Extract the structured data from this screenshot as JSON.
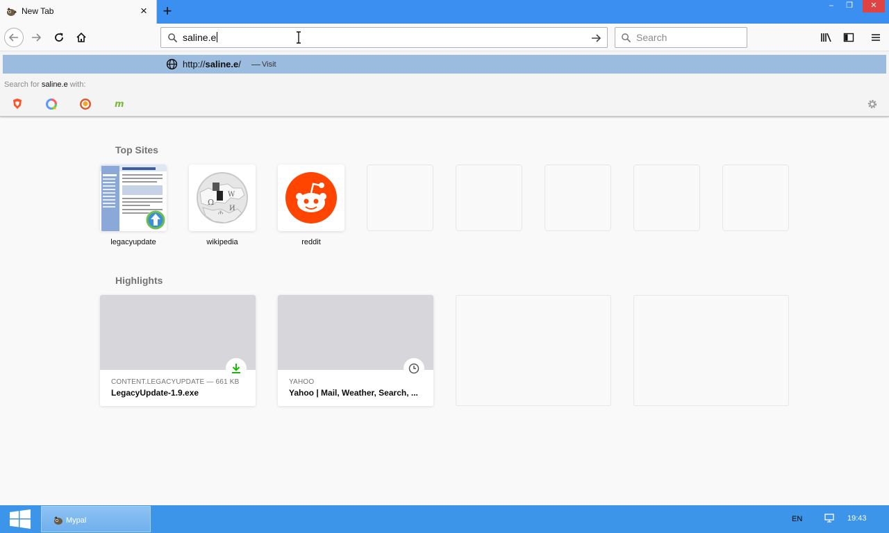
{
  "tab": {
    "title": "New Tab",
    "close_icon": "×"
  },
  "toolbar": {
    "new_tab_icon": "+"
  },
  "window_controls": {
    "minimize": "–",
    "maximize": "❐",
    "close": "✕"
  },
  "urlbar": {
    "value": "saline.e"
  },
  "searchbar": {
    "placeholder": "Search"
  },
  "dropdown": {
    "suggestion_prefix": "http://",
    "suggestion_host": "saline.e",
    "suggestion_suffix": "/",
    "separator": "—",
    "action": "Visit",
    "search_with_prefix": "Search for",
    "search_with_term": "saline.e",
    "search_with_suffix": "with:"
  },
  "top_sites": {
    "title": "Top Sites",
    "items": [
      {
        "label": "legacyupdate"
      },
      {
        "label": "wikipedia"
      },
      {
        "label": "reddit"
      }
    ]
  },
  "highlights": {
    "title": "Highlights",
    "items": [
      {
        "source": "CONTENT.LEGACYUPDATE — 661 KB",
        "title": "LegacyUpdate-1.9.exe"
      },
      {
        "source": "YAHOO",
        "title": "Yahoo | Mail, Weather, Search, ..."
      }
    ]
  },
  "taskbar": {
    "app_label": "Mypal",
    "language": "EN",
    "time": "19:43"
  },
  "colors": {
    "titlebar": "#3b8ff0",
    "selected_suggestion": "#9cbcdf",
    "reddit": "#ff4500",
    "download_green": "#12bc00",
    "taskbar": "#3c95e8",
    "close_red": "#e04343"
  }
}
